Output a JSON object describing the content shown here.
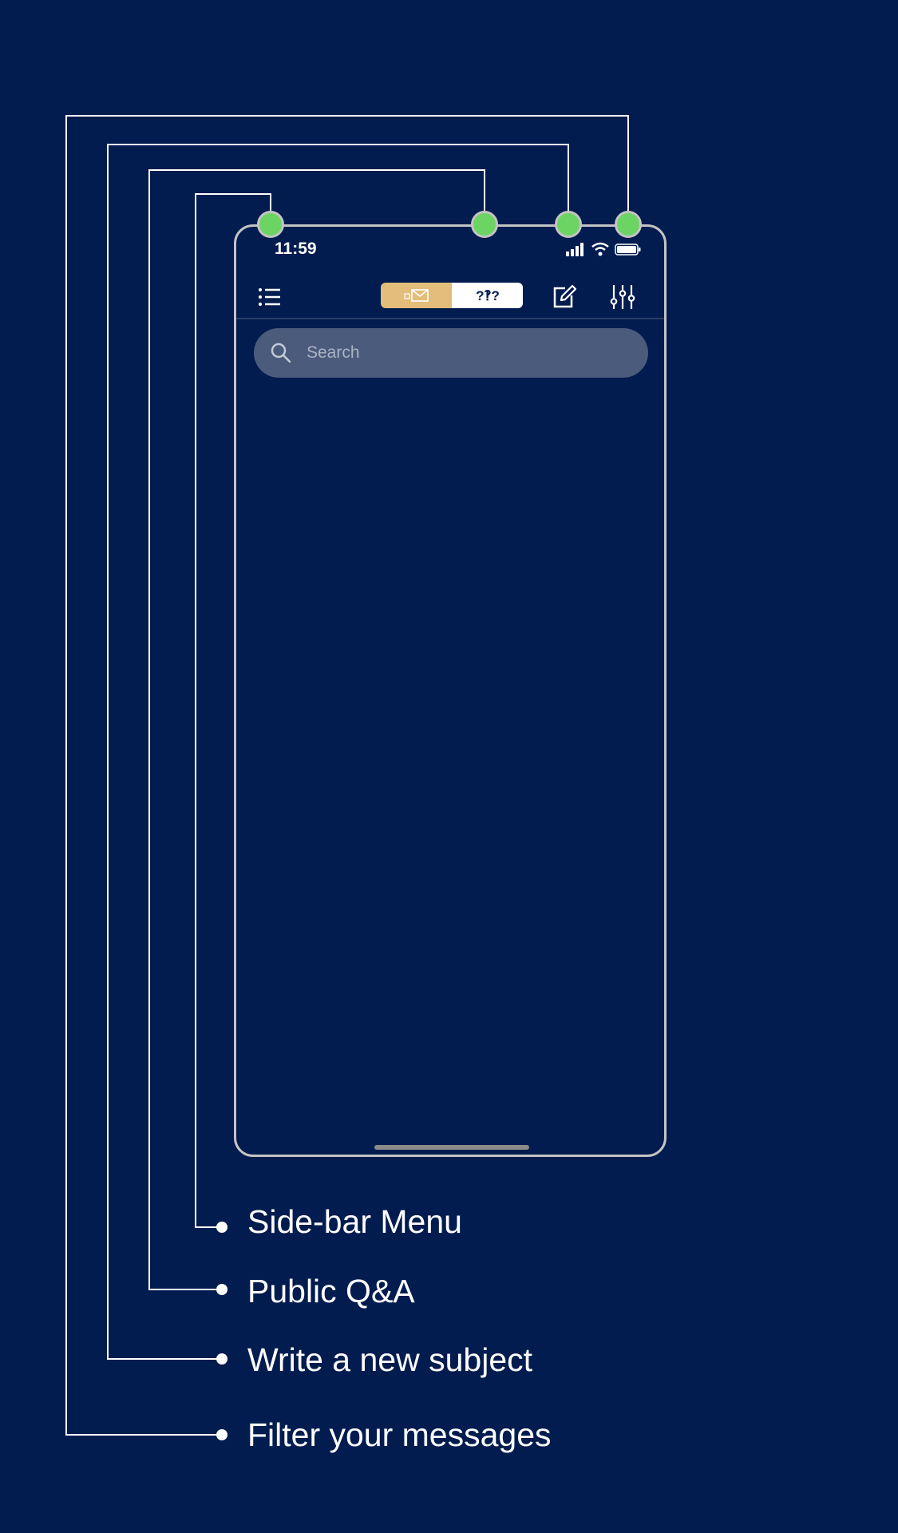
{
  "status_bar": {
    "time": "11:59"
  },
  "toolbar": {
    "menu_icon": "list-icon",
    "segment_mail_icon": "envelope-icon",
    "segment_qa_icon": "question-marks-icon",
    "compose_icon": "compose-icon",
    "filter_icon": "sliders-icon",
    "selected_segment": "mail"
  },
  "search": {
    "placeholder": "Search",
    "value": ""
  },
  "callouts": [
    {
      "label": "Side-bar Menu"
    },
    {
      "label": "Public Q&A"
    },
    {
      "label": "Write a new subject"
    },
    {
      "label": "Filter your messages"
    }
  ],
  "colors": {
    "background": "#021c4f",
    "accent_gold": "#e3bd79",
    "marker_green": "#6cd463",
    "search_fill": "#4b5b7c",
    "frame_gray": "#c4c4c4"
  }
}
